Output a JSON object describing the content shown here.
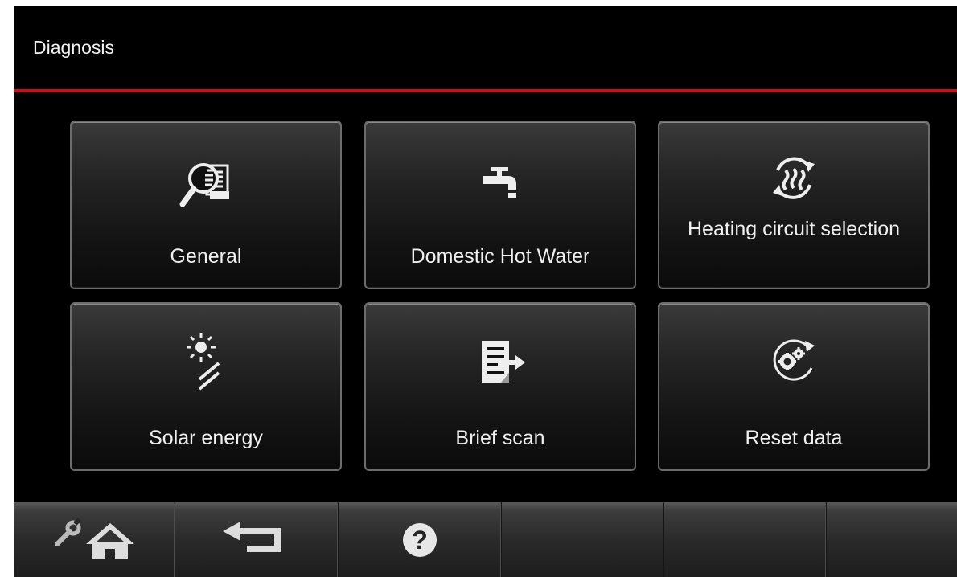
{
  "header": {
    "title": "Diagnosis"
  },
  "tiles": [
    {
      "label": "General",
      "icon": "magnifier-document-icon"
    },
    {
      "label": "Domestic Hot Water",
      "icon": "faucet-icon"
    },
    {
      "label": "Heating circuit selection",
      "icon": "heating-circuit-icon"
    },
    {
      "label": "Solar energy",
      "icon": "solar-panel-icon"
    },
    {
      "label": "Brief scan",
      "icon": "document-arrow-icon"
    },
    {
      "label": "Reset data",
      "icon": "reset-gears-icon"
    }
  ],
  "footer": {
    "buttons": [
      {
        "icon": "wrench-home-icon"
      },
      {
        "icon": "back-arrow-icon"
      },
      {
        "icon": "help-icon",
        "glyph": "?"
      }
    ]
  },
  "colors": {
    "accent": "#c8101f",
    "background": "#000000",
    "text": "#f0f0f0"
  }
}
